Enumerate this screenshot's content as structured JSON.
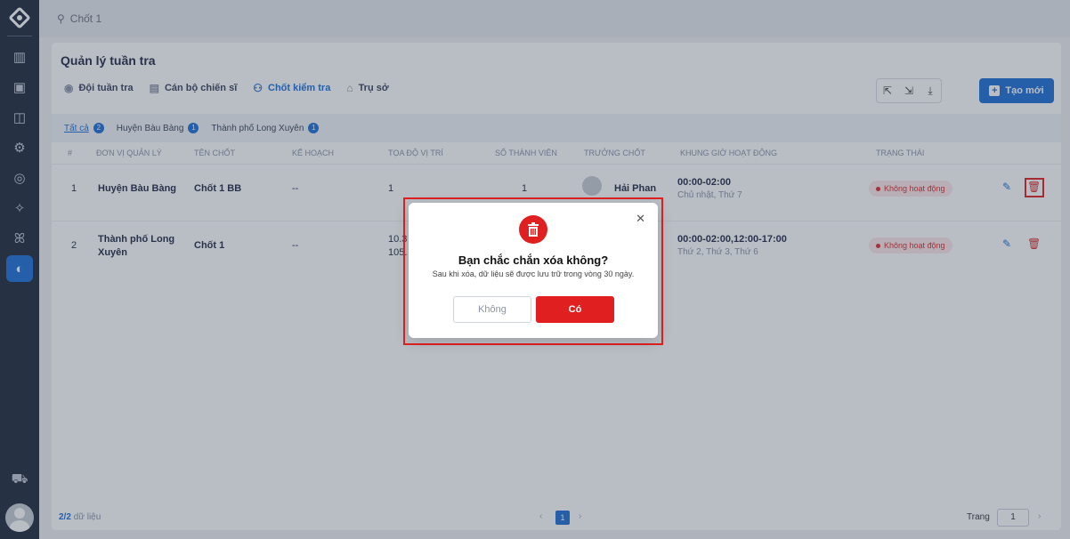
{
  "topbar": {
    "search_icon": "search-icon",
    "search_text": "Chốt 1"
  },
  "page": {
    "title": "Quản lý tuần tra",
    "create_label": "Tạo mới"
  },
  "tabs": [
    {
      "label": "Đội tuần tra",
      "icon": "eye-icon"
    },
    {
      "label": "Cán bộ chiến sĩ",
      "icon": "id-card-icon"
    },
    {
      "label": "Chốt kiểm tra",
      "icon": "checkpoint-icon",
      "active": true
    },
    {
      "label": "Trụ sở",
      "icon": "building-icon"
    }
  ],
  "filters": [
    {
      "label": "Tất cả",
      "badge": "2",
      "active": true
    },
    {
      "label": "Huyện Bàu Bàng",
      "badge": "1"
    },
    {
      "label": "Thành phố Long Xuyên",
      "badge": "1"
    }
  ],
  "table": {
    "headers": [
      "#",
      "ĐƠN VỊ QUẢN LÝ",
      "TÊN CHỐT",
      "KẾ HOẠCH",
      "TỌA ĐỘ VỊ TRÍ",
      "SỐ THÀNH VIÊN",
      "TRƯỞNG CHỐT",
      "KHUNG GIỜ HOẠT ĐỘNG",
      "TRẠNG THÁI"
    ],
    "rows": [
      {
        "index": "1",
        "unit": "Huyện Bàu Bàng",
        "name": "Chốt 1 BB",
        "plan": "--",
        "coord": "1",
        "members": "1",
        "leader": "Hải Phan",
        "time": "00:00-02:00",
        "days": "Chủ nhật, Thứ 7",
        "status": "Không hoạt động"
      },
      {
        "index": "2",
        "unit_line1": "Thành phố Long",
        "unit_line2": "Xuyên",
        "name": "Chốt 1",
        "plan": "--",
        "coord_line1": "10.3",
        "coord_line2": "105.",
        "time": "00:00-02:00,12:00-17:00",
        "days": "Thứ 2, Thứ 3, Thứ 6",
        "status": "Không hoạt động"
      }
    ]
  },
  "footer": {
    "count_bold": "2/2",
    "count_text": "dữ liệu",
    "page": "1",
    "page_label": "Trang",
    "page_value": "1"
  },
  "modal": {
    "title": "Bạn chắc chắn xóa không?",
    "message": "Sau khi xóa, dữ liệu sẽ được lưu trữ trong vòng 30 ngày.",
    "cancel_label": "Không",
    "confirm_label": "Có",
    "close_glyph": "✕"
  },
  "colors": {
    "primary": "#1d6fd6",
    "danger": "#e02020",
    "sidebar": "#1e2a3a"
  }
}
